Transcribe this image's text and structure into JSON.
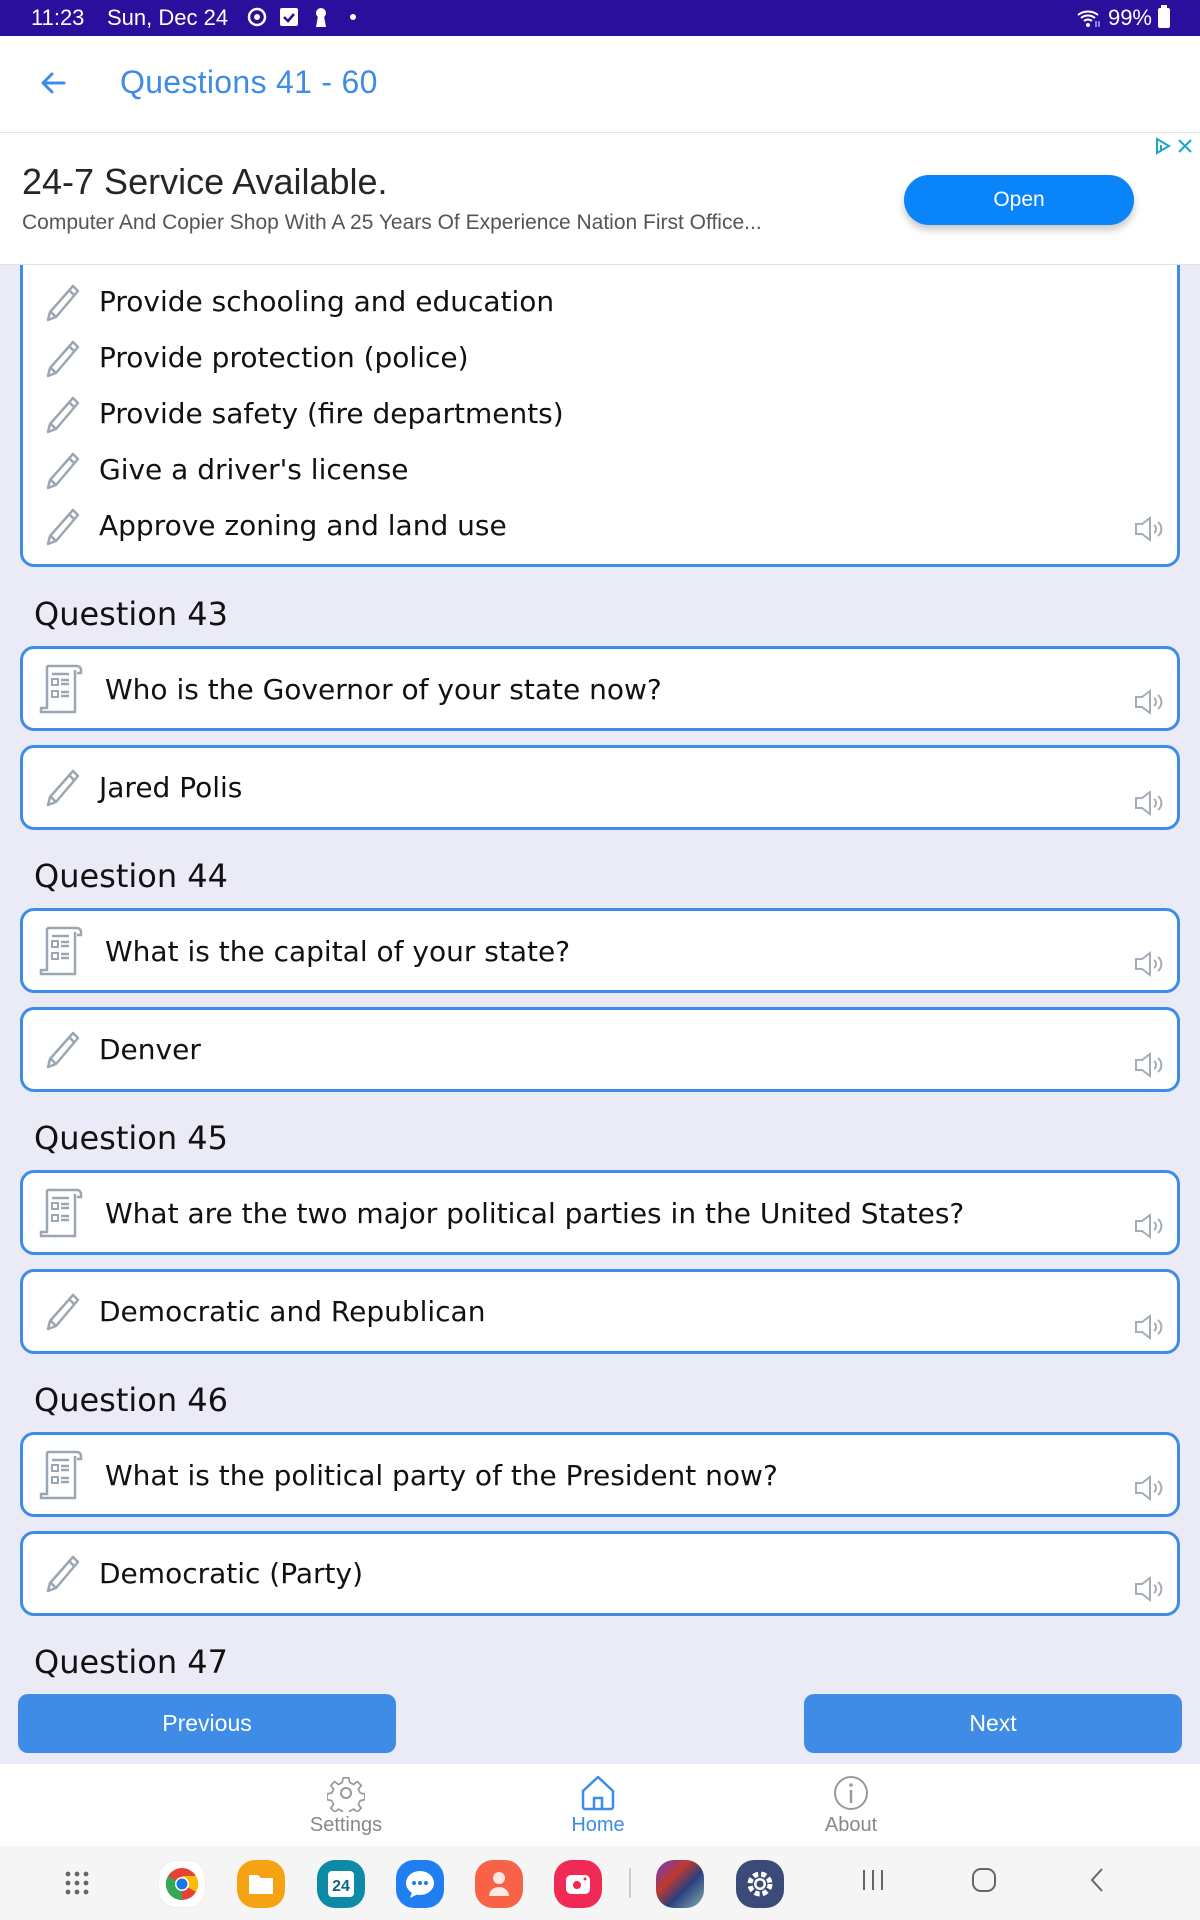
{
  "status_bar": {
    "time": "11:23",
    "date": "Sun, Dec 24",
    "icons": [
      "smart-things-icon",
      "checkbox-icon",
      "keyhole-icon",
      "dot-icon"
    ],
    "battery": "99%"
  },
  "header": {
    "title": "Questions 41 - 60",
    "accent_color": "#3f8ce6"
  },
  "ad": {
    "title": "24-7 Service Available.",
    "description": "Computer And Copier Shop With A 25 Years Of Experience Nation First Office...",
    "button_label": "Open",
    "button_color": "#0a84f9"
  },
  "partial_answer": {
    "items": [
      "Provide schooling and education",
      "Provide protection (police)",
      "Provide safety (fire departments)",
      "Give a driver's license",
      "Approve zoning and land use"
    ]
  },
  "questions": [
    {
      "label": "Question 43",
      "question": "Who is the Governor of your state now?",
      "answer": "Jared Polis"
    },
    {
      "label": "Question 44",
      "question": "What is the capital of your state?",
      "answer": "Denver"
    },
    {
      "label": "Question 45",
      "question": "What are the two major political parties in the United States?",
      "answer": "Democratic and Republican"
    },
    {
      "label": "Question 46",
      "question": "What is the political party of the President now?",
      "answer": "Democratic (Party)"
    },
    {
      "label": "Question 47"
    }
  ],
  "pager": {
    "previous_label": "Previous",
    "next_label": "Next"
  },
  "tabbar": {
    "tabs": [
      {
        "label": "Settings",
        "icon": "gear-icon",
        "active": false
      },
      {
        "label": "Home",
        "icon": "home-icon",
        "active": true
      },
      {
        "label": "About",
        "icon": "info-icon",
        "active": false
      }
    ]
  },
  "dock": {
    "apps": [
      "Chrome",
      "My Files",
      "Calendar",
      "Messages",
      "Contacts",
      "Screen Recorder",
      "Citizenship Test",
      "Settings"
    ],
    "calendar_day": "24"
  }
}
